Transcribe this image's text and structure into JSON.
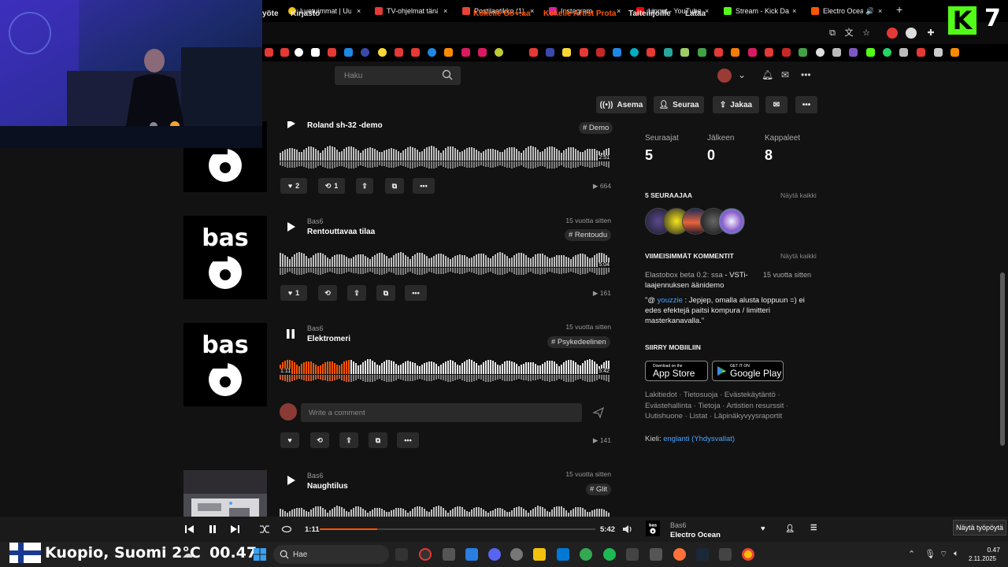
{
  "browser": {
    "tabs": [
      {
        "label": "Luetuimmat | Uut",
        "color": "#f4c20d"
      },
      {
        "label": "TV-ohjelmat tänä",
        "color": "#e53935"
      },
      {
        "label": "Postilaatikko (1) -",
        "color": "#ea4335"
      },
      {
        "label": "Instagram",
        "color": "#d6249f"
      },
      {
        "label": "Linnut - YouTube",
        "color": "#ff0000"
      },
      {
        "label": "Stream - Kick Da",
        "color": "#53fc18"
      },
      {
        "label": "Electro Ocea",
        "color": "#ff5500"
      }
    ],
    "kick_badge": "K",
    "kick_number": "7"
  },
  "nav": {
    "stream_partial": "yöte",
    "library": "Kirjasto",
    "search_placeholder": "Haku",
    "try_go": "Kokeile Go+:aa",
    "try_artist": "Kokeile Artist Prota",
    "for_artists": "Taiteilijoille",
    "upload": "Lataa"
  },
  "actions": {
    "station": "Asema",
    "follow": "Seuraa",
    "share": "Jakaa"
  },
  "tracks": [
    {
      "artist": "",
      "title": "Roland sh-32 -demo",
      "ago": "",
      "tag": "# Demo",
      "duration": "2:51",
      "likes": "2",
      "reposts": "1",
      "plays": "664",
      "art": "bas6"
    },
    {
      "artist": "Bas6",
      "title": "Rentouttavaa tilaa",
      "ago": "15 vuotta sitten",
      "tag": "# Rentoudu",
      "duration": "5:04",
      "likes": "1",
      "reposts": "",
      "plays": "161",
      "art": "bas6"
    },
    {
      "artist": "Bas6",
      "title": "Elektromeri",
      "ago": "15 vuotta sitten",
      "tag": "# Psykedeelinen",
      "duration": "5:42",
      "position": "1:11",
      "progress": 0.208,
      "likes": "",
      "reposts": "",
      "plays": "141",
      "art": "bas6"
    },
    {
      "artist": "Bas6",
      "title": "Naughtilus",
      "ago": "15 vuotta sitten",
      "tag": "# Glit",
      "duration": "",
      "plays": "",
      "art": "photo"
    }
  ],
  "comment_placeholder": "Write a comment",
  "sidebar": {
    "stats": [
      {
        "label": "Seuraajat",
        "value": "5"
      },
      {
        "label": "Jälkeen",
        "value": "0"
      },
      {
        "label": "Kappaleet",
        "value": "8"
      }
    ],
    "followers_heading": "5 SEURAAJAA",
    "show_all": "Näytä kaikki",
    "comments_heading": "VIIMEISIMMÄT KOMMENTIT",
    "comment": {
      "source_a": "Elastobox beta 0.2: ssa",
      "source_b": " - VSTi-",
      "source_c": "laajennuksen äänidemo",
      "ago": "15 vuotta sitten",
      "quote_open": "\"@ ",
      "user": "youzzie",
      "text_1": " : Jepjep, omalla alusta loppuun =) ei",
      "text_2": "edes efektejä paitsi kompura / limitteri",
      "text_3": "masterkanavalla.\""
    },
    "mobile_heading": "SIIRRY MOBIILIIN",
    "appstore_small": "Download on the",
    "appstore_big": "App Store",
    "play_small": "GET IT ON",
    "play_big": "Google Play",
    "footer": [
      "Lakitiedot",
      "Tietosuoja",
      "Evästekäytäntö",
      "Evästehallinta",
      "Tietoja",
      "Artistien resurssit",
      "Uutishuone",
      "Listat",
      "Läpinäkyvyysraportit"
    ],
    "language_label": "Kieli:",
    "language_value": "englanti (Yhdysvallat)"
  },
  "player": {
    "position": "1:11",
    "duration": "5:42",
    "progress": 0.208,
    "artist": "Bas6",
    "title": "Electro Ocean"
  },
  "tooltip": "Näytä työpöytä",
  "taskbar": {
    "weather": "Kuopio, Suomi 2°C",
    "time_big": "00.47",
    "search_placeholder": "Hae",
    "time": "0.47",
    "date": "2.11.2025"
  },
  "colors": {
    "accent": "#ff5500",
    "bg": "#121212",
    "link": "#4aa3ff"
  }
}
